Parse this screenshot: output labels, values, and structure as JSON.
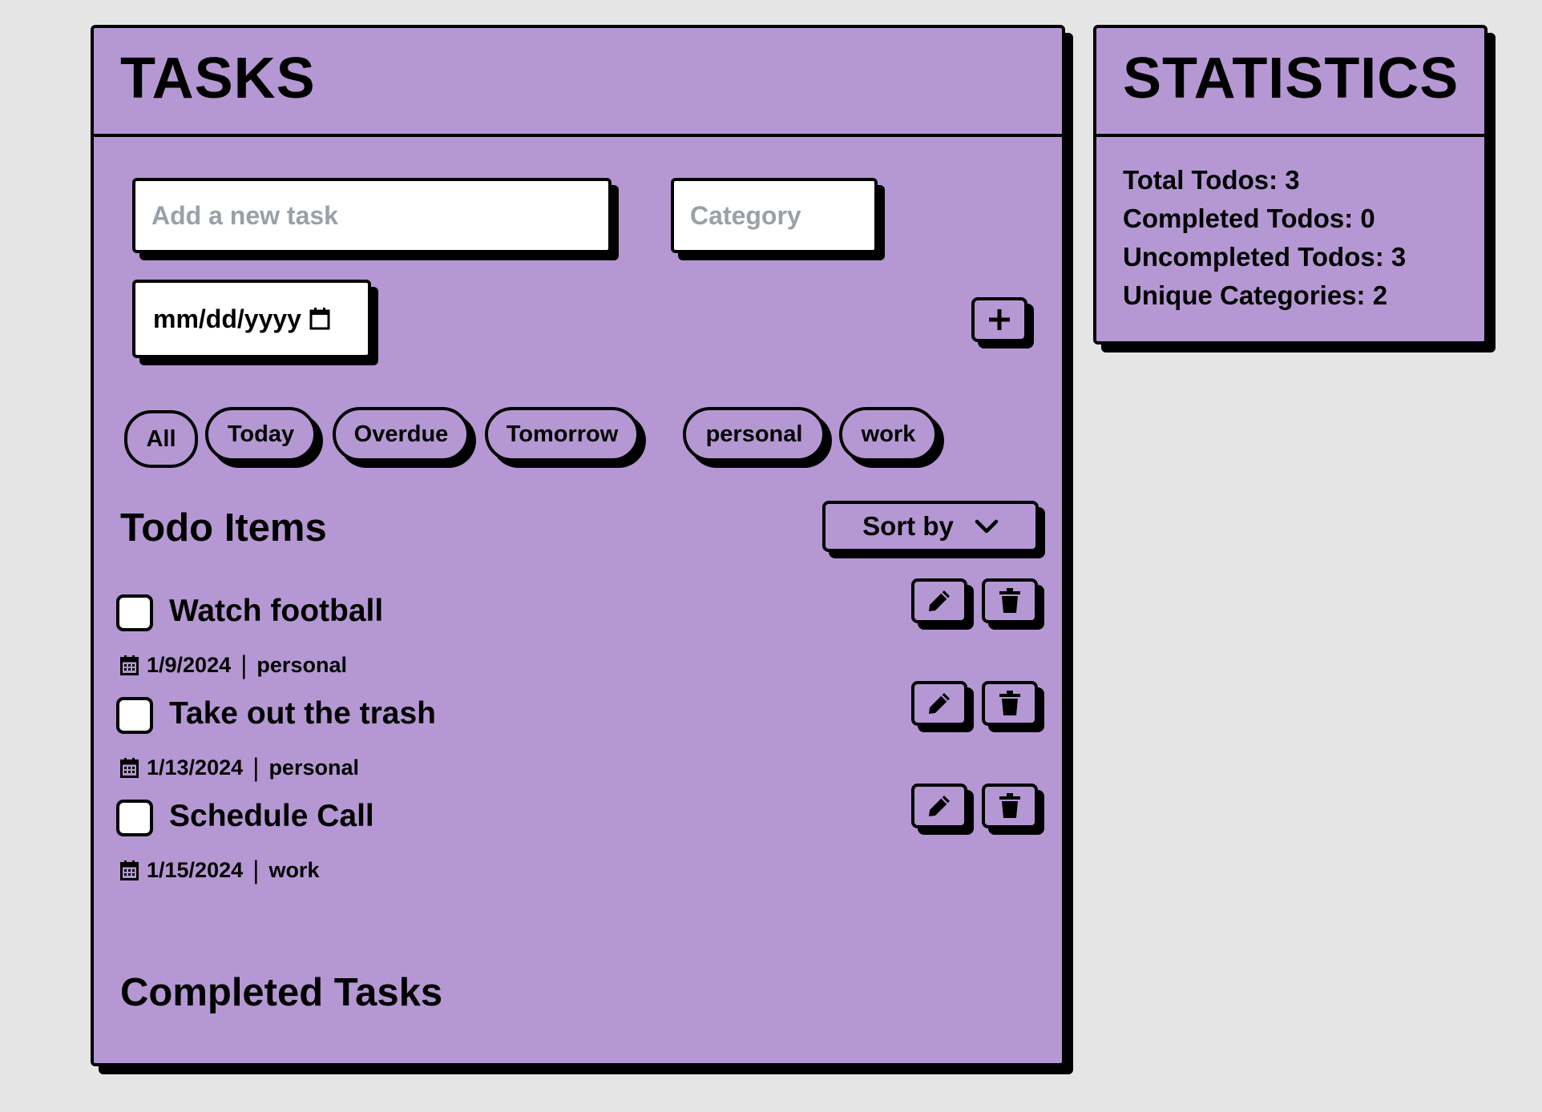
{
  "tasks": {
    "title": "TASKS",
    "task_input_placeholder": "Add a new task",
    "category_placeholder": "Category",
    "date_placeholder": "mm/dd/yyyy",
    "add_button_label": "+",
    "filters": [
      "All",
      "Today",
      "Overdue",
      "Tomorrow"
    ],
    "categories": [
      "personal",
      "work"
    ],
    "todo_heading": "Todo Items",
    "sort_label": "Sort by",
    "todos": [
      {
        "title": "Watch football",
        "date": "1/9/2024",
        "category": "personal",
        "completed": false
      },
      {
        "title": "Take out the trash",
        "date": "1/13/2024",
        "category": "personal",
        "completed": false
      },
      {
        "title": "Schedule Call",
        "date": "1/15/2024",
        "category": "work",
        "completed": false
      }
    ],
    "completed_heading": "Completed Tasks"
  },
  "statistics": {
    "title": "STATISTICS",
    "lines": [
      "Total Todos: 3",
      "Completed Todos: 0",
      "Uncompleted Todos: 3",
      "Unique Categories: 2"
    ]
  },
  "colors": {
    "background": "#e5e5e5",
    "panel": "#b598d3",
    "border": "#000000",
    "placeholder": "#9aa0a8"
  },
  "icons": [
    "calendar-icon",
    "plus-icon",
    "chevron-down-icon",
    "pencil-icon",
    "trash-icon"
  ]
}
